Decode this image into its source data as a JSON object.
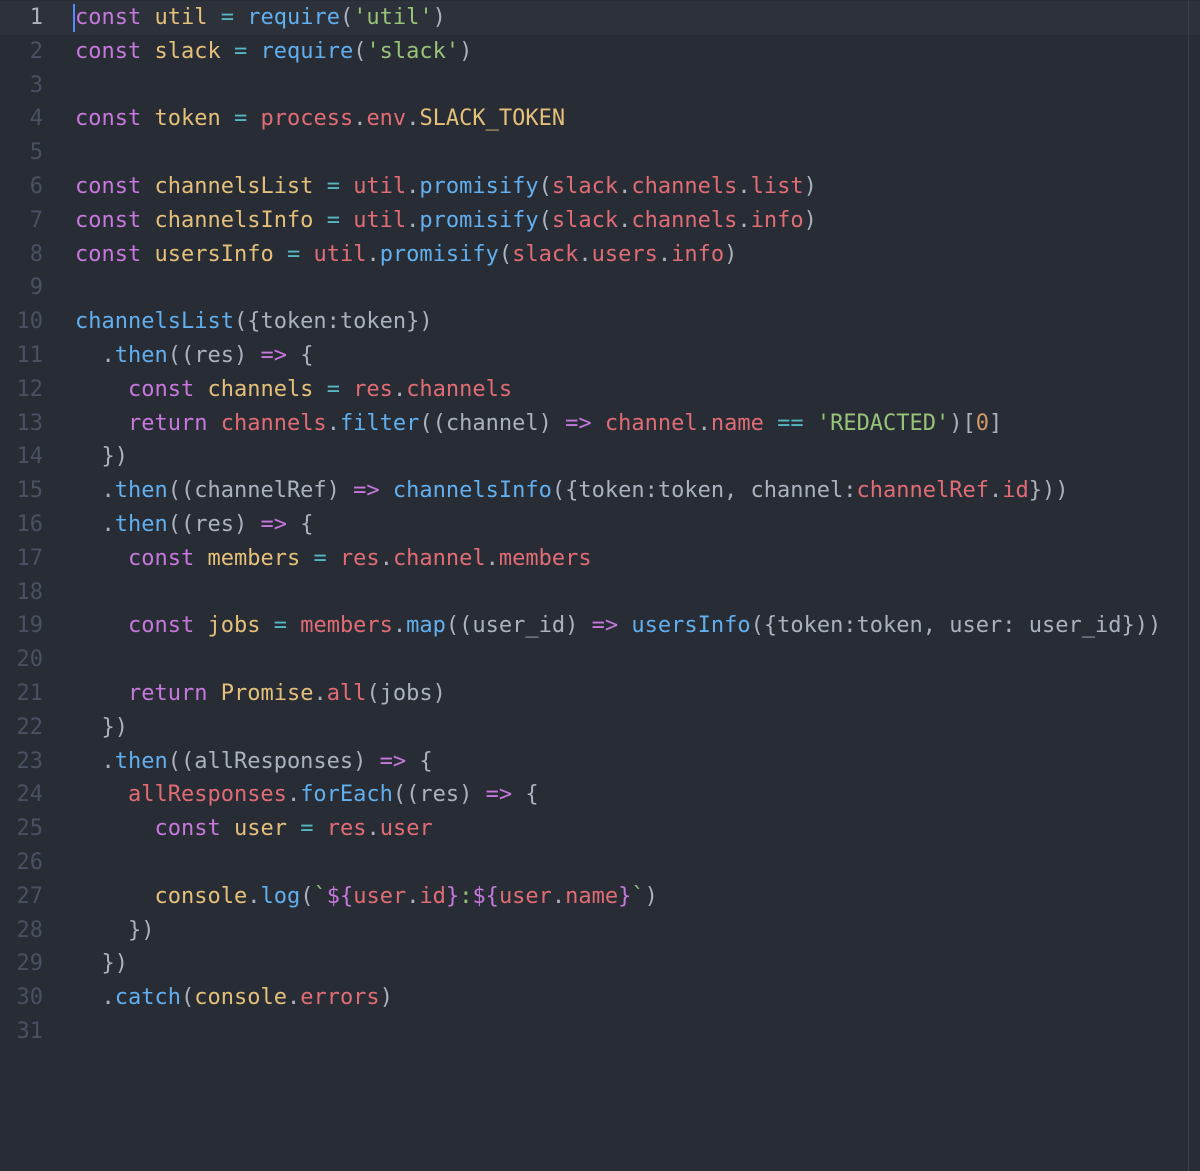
{
  "editor": {
    "theme_colors": {
      "background": "#282c34",
      "keyword": "#c678dd",
      "variable": "#e5c07b",
      "operator": "#56b6c2",
      "function": "#61afef",
      "string": "#98c379",
      "property": "#e06c75",
      "number": "#d19a66",
      "plain": "#abb2bf",
      "gutter_text": "#495162"
    },
    "cursor_line": 1,
    "lines": [
      {
        "n": "1",
        "tokens": [
          [
            "kw",
            "const"
          ],
          [
            "pn",
            " "
          ],
          [
            "vr",
            "util"
          ],
          [
            "pn",
            " "
          ],
          [
            "op",
            "="
          ],
          [
            "pn",
            " "
          ],
          [
            "fn",
            "require"
          ],
          [
            "pn",
            "("
          ],
          [
            "str",
            "'util'"
          ],
          [
            "pn",
            ")"
          ]
        ]
      },
      {
        "n": "2",
        "tokens": [
          [
            "kw",
            "const"
          ],
          [
            "pn",
            " "
          ],
          [
            "vr",
            "slack"
          ],
          [
            "pn",
            " "
          ],
          [
            "op",
            "="
          ],
          [
            "pn",
            " "
          ],
          [
            "fn",
            "require"
          ],
          [
            "pn",
            "("
          ],
          [
            "str",
            "'slack'"
          ],
          [
            "pn",
            ")"
          ]
        ]
      },
      {
        "n": "3",
        "tokens": []
      },
      {
        "n": "4",
        "tokens": [
          [
            "kw",
            "const"
          ],
          [
            "pn",
            " "
          ],
          [
            "vr",
            "token"
          ],
          [
            "pn",
            " "
          ],
          [
            "op",
            "="
          ],
          [
            "pn",
            " "
          ],
          [
            "obj",
            "process"
          ],
          [
            "pn",
            "."
          ],
          [
            "obj",
            "env"
          ],
          [
            "pn",
            "."
          ],
          [
            "vr",
            "SLACK_TOKEN"
          ]
        ]
      },
      {
        "n": "5",
        "tokens": []
      },
      {
        "n": "6",
        "tokens": [
          [
            "kw",
            "const"
          ],
          [
            "pn",
            " "
          ],
          [
            "vr",
            "channelsList"
          ],
          [
            "pn",
            " "
          ],
          [
            "op",
            "="
          ],
          [
            "pn",
            " "
          ],
          [
            "obj",
            "util"
          ],
          [
            "pn",
            "."
          ],
          [
            "fn",
            "promisify"
          ],
          [
            "pn",
            "("
          ],
          [
            "obj",
            "slack"
          ],
          [
            "pn",
            "."
          ],
          [
            "obj",
            "channels"
          ],
          [
            "pn",
            "."
          ],
          [
            "obj",
            "list"
          ],
          [
            "pn",
            ")"
          ]
        ]
      },
      {
        "n": "7",
        "tokens": [
          [
            "kw",
            "const"
          ],
          [
            "pn",
            " "
          ],
          [
            "vr",
            "channelsInfo"
          ],
          [
            "pn",
            " "
          ],
          [
            "op",
            "="
          ],
          [
            "pn",
            " "
          ],
          [
            "obj",
            "util"
          ],
          [
            "pn",
            "."
          ],
          [
            "fn",
            "promisify"
          ],
          [
            "pn",
            "("
          ],
          [
            "obj",
            "slack"
          ],
          [
            "pn",
            "."
          ],
          [
            "obj",
            "channels"
          ],
          [
            "pn",
            "."
          ],
          [
            "obj",
            "info"
          ],
          [
            "pn",
            ")"
          ]
        ]
      },
      {
        "n": "8",
        "tokens": [
          [
            "kw",
            "const"
          ],
          [
            "pn",
            " "
          ],
          [
            "vr",
            "usersInfo"
          ],
          [
            "pn",
            " "
          ],
          [
            "op",
            "="
          ],
          [
            "pn",
            " "
          ],
          [
            "obj",
            "util"
          ],
          [
            "pn",
            "."
          ],
          [
            "fn",
            "promisify"
          ],
          [
            "pn",
            "("
          ],
          [
            "obj",
            "slack"
          ],
          [
            "pn",
            "."
          ],
          [
            "obj",
            "users"
          ],
          [
            "pn",
            "."
          ],
          [
            "obj",
            "info"
          ],
          [
            "pn",
            ")"
          ]
        ]
      },
      {
        "n": "9",
        "tokens": []
      },
      {
        "n": "10",
        "tokens": [
          [
            "fn",
            "channelsList"
          ],
          [
            "pn",
            "({token:token})"
          ]
        ]
      },
      {
        "n": "11",
        "tokens": [
          [
            "pn",
            "  ."
          ],
          [
            "fn",
            "then"
          ],
          [
            "pn",
            "((res) "
          ],
          [
            "kw",
            "=>"
          ],
          [
            "pn",
            " {"
          ]
        ]
      },
      {
        "n": "12",
        "tokens": [
          [
            "pn",
            "    "
          ],
          [
            "kw",
            "const"
          ],
          [
            "pn",
            " "
          ],
          [
            "vr",
            "channels"
          ],
          [
            "pn",
            " "
          ],
          [
            "op",
            "="
          ],
          [
            "pn",
            " "
          ],
          [
            "obj",
            "res"
          ],
          [
            "pn",
            "."
          ],
          [
            "obj",
            "channels"
          ]
        ]
      },
      {
        "n": "13",
        "tokens": [
          [
            "pn",
            "    "
          ],
          [
            "kw",
            "return"
          ],
          [
            "pn",
            " "
          ],
          [
            "obj",
            "channels"
          ],
          [
            "pn",
            "."
          ],
          [
            "fn",
            "filter"
          ],
          [
            "pn",
            "((channel) "
          ],
          [
            "kw",
            "=>"
          ],
          [
            "pn",
            " "
          ],
          [
            "obj",
            "channel"
          ],
          [
            "pn",
            "."
          ],
          [
            "obj",
            "name"
          ],
          [
            "pn",
            " "
          ],
          [
            "op",
            "=="
          ],
          [
            "pn",
            " "
          ],
          [
            "str",
            "'REDACTED'"
          ],
          [
            "pn",
            ")["
          ],
          [
            "num-lit",
            "0"
          ],
          [
            "pn",
            "]"
          ]
        ]
      },
      {
        "n": "14",
        "tokens": [
          [
            "pn",
            "  })"
          ]
        ]
      },
      {
        "n": "15",
        "tokens": [
          [
            "pn",
            "  ."
          ],
          [
            "fn",
            "then"
          ],
          [
            "pn",
            "((channelRef) "
          ],
          [
            "kw",
            "=>"
          ],
          [
            "pn",
            " "
          ],
          [
            "fn",
            "channelsInfo"
          ],
          [
            "pn",
            "({token:token, channel:"
          ],
          [
            "obj",
            "channelRef"
          ],
          [
            "pn",
            "."
          ],
          [
            "obj",
            "id"
          ],
          [
            "pn",
            "}))"
          ]
        ]
      },
      {
        "n": "16",
        "tokens": [
          [
            "pn",
            "  ."
          ],
          [
            "fn",
            "then"
          ],
          [
            "pn",
            "((res) "
          ],
          [
            "kw",
            "=>"
          ],
          [
            "pn",
            " {"
          ]
        ]
      },
      {
        "n": "17",
        "tokens": [
          [
            "pn",
            "    "
          ],
          [
            "kw",
            "const"
          ],
          [
            "pn",
            " "
          ],
          [
            "vr",
            "members"
          ],
          [
            "pn",
            " "
          ],
          [
            "op",
            "="
          ],
          [
            "pn",
            " "
          ],
          [
            "obj",
            "res"
          ],
          [
            "pn",
            "."
          ],
          [
            "obj",
            "channel"
          ],
          [
            "pn",
            "."
          ],
          [
            "obj",
            "members"
          ]
        ]
      },
      {
        "n": "18",
        "tokens": []
      },
      {
        "n": "19",
        "tokens": [
          [
            "pn",
            "    "
          ],
          [
            "kw",
            "const"
          ],
          [
            "pn",
            " "
          ],
          [
            "vr",
            "jobs"
          ],
          [
            "pn",
            " "
          ],
          [
            "op",
            "="
          ],
          [
            "pn",
            " "
          ],
          [
            "obj",
            "members"
          ],
          [
            "pn",
            "."
          ],
          [
            "fn",
            "map"
          ],
          [
            "pn",
            "((user_id) "
          ],
          [
            "kw",
            "=>"
          ],
          [
            "pn",
            " "
          ],
          [
            "fn",
            "usersInfo"
          ],
          [
            "pn",
            "({token:token, user: user_id}))"
          ]
        ]
      },
      {
        "n": "20",
        "tokens": []
      },
      {
        "n": "21",
        "tokens": [
          [
            "pn",
            "    "
          ],
          [
            "kw",
            "return"
          ],
          [
            "pn",
            " "
          ],
          [
            "vr",
            "Promise"
          ],
          [
            "pn",
            "."
          ],
          [
            "obj",
            "all"
          ],
          [
            "pn",
            "(jobs)"
          ]
        ]
      },
      {
        "n": "22",
        "tokens": [
          [
            "pn",
            "  })"
          ]
        ]
      },
      {
        "n": "23",
        "tokens": [
          [
            "pn",
            "  ."
          ],
          [
            "fn",
            "then"
          ],
          [
            "pn",
            "((allResponses) "
          ],
          [
            "kw",
            "=>"
          ],
          [
            "pn",
            " {"
          ]
        ]
      },
      {
        "n": "24",
        "tokens": [
          [
            "pn",
            "    "
          ],
          [
            "obj",
            "allResponses"
          ],
          [
            "pn",
            "."
          ],
          [
            "fn",
            "forEach"
          ],
          [
            "pn",
            "((res) "
          ],
          [
            "kw",
            "=>"
          ],
          [
            "pn",
            " {"
          ]
        ]
      },
      {
        "n": "25",
        "tokens": [
          [
            "pn",
            "      "
          ],
          [
            "kw",
            "const"
          ],
          [
            "pn",
            " "
          ],
          [
            "vr",
            "user"
          ],
          [
            "pn",
            " "
          ],
          [
            "op",
            "="
          ],
          [
            "pn",
            " "
          ],
          [
            "obj",
            "res"
          ],
          [
            "pn",
            "."
          ],
          [
            "obj",
            "user"
          ]
        ]
      },
      {
        "n": "26",
        "tokens": []
      },
      {
        "n": "27",
        "tokens": [
          [
            "pn",
            "      "
          ],
          [
            "vr",
            "console"
          ],
          [
            "pn",
            "."
          ],
          [
            "fn",
            "log"
          ],
          [
            "pn",
            "("
          ],
          [
            "str",
            "`"
          ],
          [
            "kw",
            "${"
          ],
          [
            "obj",
            "user"
          ],
          [
            "pn",
            "."
          ],
          [
            "obj",
            "id"
          ],
          [
            "kw",
            "}"
          ],
          [
            "str",
            ":"
          ],
          [
            "kw",
            "${"
          ],
          [
            "obj",
            "user"
          ],
          [
            "pn",
            "."
          ],
          [
            "obj",
            "name"
          ],
          [
            "kw",
            "}"
          ],
          [
            "str",
            "`"
          ],
          [
            "pn",
            ")"
          ]
        ]
      },
      {
        "n": "28",
        "tokens": [
          [
            "pn",
            "    })"
          ]
        ]
      },
      {
        "n": "29",
        "tokens": [
          [
            "pn",
            "  })"
          ]
        ]
      },
      {
        "n": "30",
        "tokens": [
          [
            "pn",
            "  ."
          ],
          [
            "fn",
            "catch"
          ],
          [
            "pn",
            "("
          ],
          [
            "vr",
            "console"
          ],
          [
            "pn",
            "."
          ],
          [
            "obj",
            "errors"
          ],
          [
            "pn",
            ")"
          ]
        ]
      },
      {
        "n": "31",
        "tokens": []
      }
    ]
  }
}
